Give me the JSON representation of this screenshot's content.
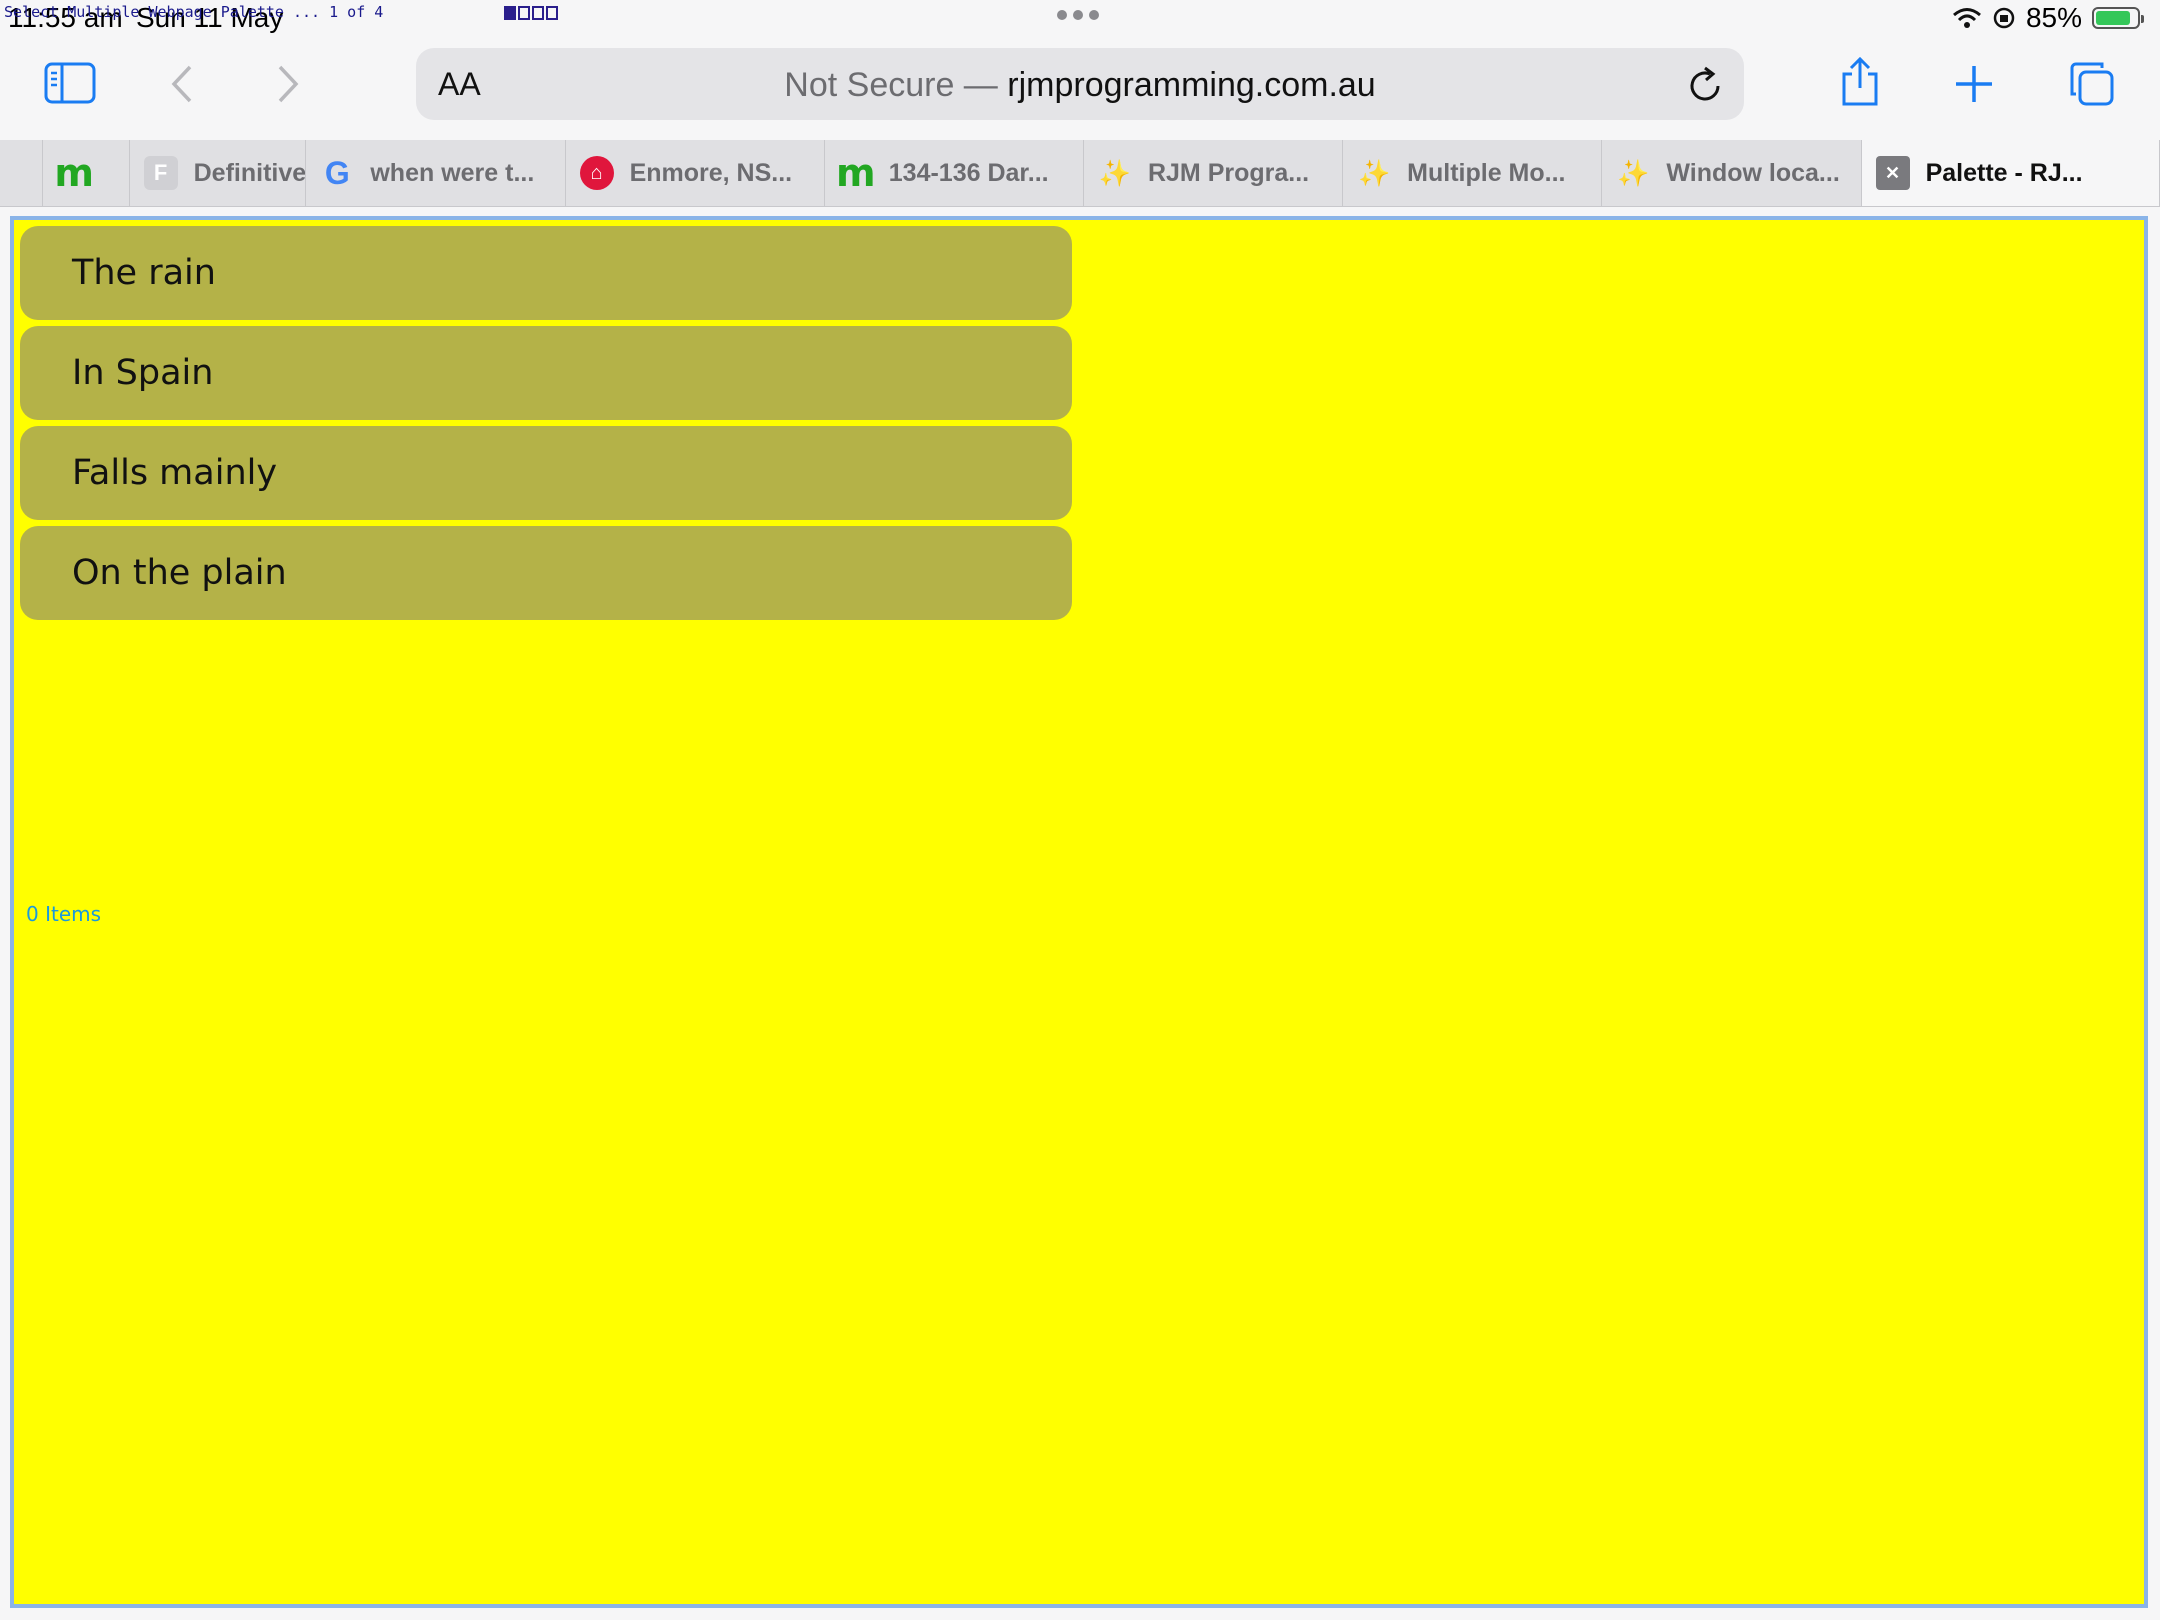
{
  "status_bar": {
    "time": "11:55 am",
    "date": "Sun 11 May",
    "overlay_label": "Select Multiple Webpage Palette ... 1 of 4",
    "battery_percent": "85%",
    "battery_level": 0.85,
    "battery_charging": true,
    "page_indicator": {
      "filled": 1,
      "total": 4
    }
  },
  "toolbar": {
    "sidebar_icon": "sidebar-icon",
    "back_icon": "chevron-left-icon",
    "forward_icon": "chevron-right-icon",
    "text_size_label": "AA",
    "url_prefix": "Not Secure — ",
    "url_domain": "rjmprogramming.com.au",
    "reload_icon": "reload-icon",
    "share_icon": "share-icon",
    "new_tab_icon": "plus-icon",
    "tabs_overview_icon": "tabs-icon"
  },
  "tabs": [
    {
      "label": "",
      "favicon": "blank"
    },
    {
      "label": "",
      "favicon": "m"
    },
    {
      "label": "Definitive",
      "favicon": "f"
    },
    {
      "label": "when were t...",
      "favicon": "g"
    },
    {
      "label": "Enmore, NS...",
      "favicon": "house"
    },
    {
      "label": "134-136 Dar...",
      "favicon": "m"
    },
    {
      "label": "RJM Progra...",
      "favicon": "wand"
    },
    {
      "label": "Multiple Mo...",
      "favicon": "wand"
    },
    {
      "label": "Window loca...",
      "favicon": "wand"
    },
    {
      "label": "Palette - RJ...",
      "favicon": "close",
      "active": true
    }
  ],
  "page": {
    "list_items": [
      "The rain",
      "In Spain",
      "Falls mainly",
      "On the plain"
    ],
    "items_count": "0 Items"
  },
  "colors": {
    "page_background": "#ffff00",
    "list_item_background": "#b4b248",
    "accent": "#1a7cf2",
    "items_count_text": "#1a9adc"
  }
}
